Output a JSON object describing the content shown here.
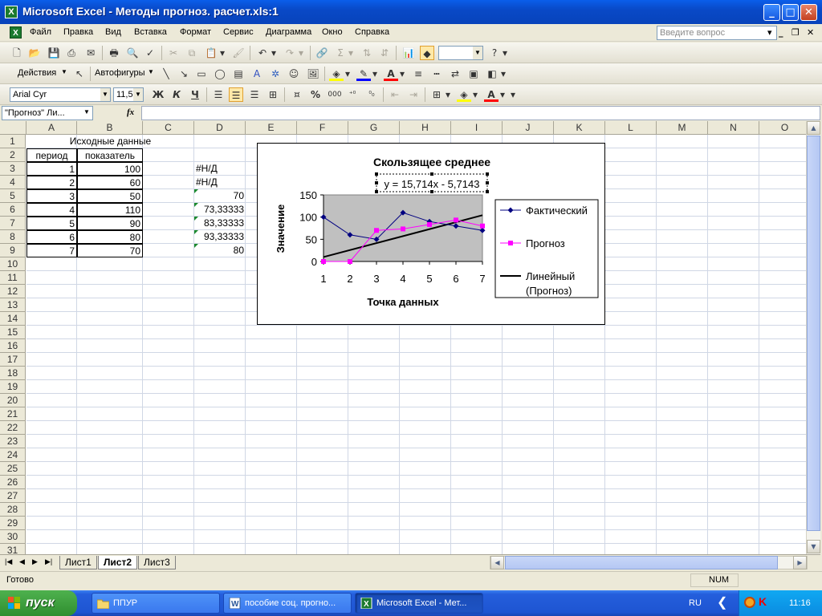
{
  "window": {
    "title": "Microsoft Excel - Методы прогноз. расчет.xls:1",
    "app_icon_letter": "X"
  },
  "menu": {
    "items": [
      "Файл",
      "Правка",
      "Вид",
      "Вставка",
      "Формат",
      "Сервис",
      "Диаграмма",
      "Окно",
      "Справка"
    ],
    "ask_placeholder": "Введите вопрос"
  },
  "toolbar": {
    "actions_label": "Действия",
    "autoshapes_label": "Автофигуры",
    "font_name": "Arial Cyr",
    "font_size": "11,5",
    "bold": "Ж",
    "italic": "К",
    "underline": "Ч",
    "percent": "%",
    "thousands": "000"
  },
  "formula_bar": {
    "name_box": "\"Прогноз\" Ли...",
    "fx": "fx",
    "formula": ""
  },
  "grid": {
    "columns": [
      "A",
      "B",
      "C",
      "D",
      "E",
      "F",
      "G",
      "H",
      "I",
      "J",
      "K",
      "L",
      "M",
      "N",
      "O"
    ],
    "rows": [
      "1",
      "2",
      "3",
      "4",
      "5",
      "6",
      "7",
      "8",
      "9",
      "10",
      "11",
      "12",
      "13",
      "14",
      "15",
      "16",
      "17",
      "18",
      "19",
      "20",
      "21",
      "22",
      "23",
      "24",
      "25",
      "26",
      "27",
      "28",
      "29",
      "30",
      "31"
    ],
    "title_cell": "Исходные данные",
    "headers": [
      "период",
      "показатель"
    ],
    "data": [
      {
        "period": "1",
        "value": "100",
        "forecast": "#Н/Д"
      },
      {
        "period": "2",
        "value": "60",
        "forecast": "#Н/Д"
      },
      {
        "period": "3",
        "value": "50",
        "forecast": "70"
      },
      {
        "period": "4",
        "value": "110",
        "forecast": "73,33333"
      },
      {
        "period": "5",
        "value": "90",
        "forecast": "83,33333"
      },
      {
        "period": "6",
        "value": "80",
        "forecast": "93,33333"
      },
      {
        "period": "7",
        "value": "70",
        "forecast": "80"
      }
    ]
  },
  "chart_data": {
    "type": "line",
    "title": "Скользящее среднее",
    "xlabel": "Точка данных",
    "ylabel": "Значение",
    "categories": [
      "1",
      "2",
      "3",
      "4",
      "5",
      "6",
      "7"
    ],
    "ylim": [
      0,
      150
    ],
    "yticks": [
      "0",
      "50",
      "100",
      "150"
    ],
    "trendline_label": "y = 15,714x - 5,7143",
    "trendline": {
      "slope": 15.714,
      "intercept": -5.7143
    },
    "plot_background": "#C0C0C0",
    "series": [
      {
        "name": "Фактический",
        "values": [
          100,
          60,
          50,
          110,
          90,
          80,
          70
        ],
        "color": "#000080",
        "marker": "diamond"
      },
      {
        "name": "Прогноз",
        "values": [
          0,
          0,
          70,
          73.33333,
          83.33333,
          93.33333,
          80
        ],
        "color": "#FF00FF",
        "marker": "square"
      }
    ],
    "legend": [
      "Фактический",
      "Прогноз",
      "Линейный",
      "(Прогноз)"
    ],
    "legend_position": "right"
  },
  "sheets": {
    "tabs": [
      "Лист1",
      "Лист2",
      "Лист3"
    ],
    "active": "Лист2"
  },
  "status": {
    "left": "Готово",
    "num": "NUM"
  },
  "taskbar": {
    "start": "пуск",
    "tasks": [
      "ППУР",
      "пособие соц. прогно...",
      "Microsoft Excel - Мет..."
    ],
    "lang": "RU",
    "time": "11:16"
  }
}
